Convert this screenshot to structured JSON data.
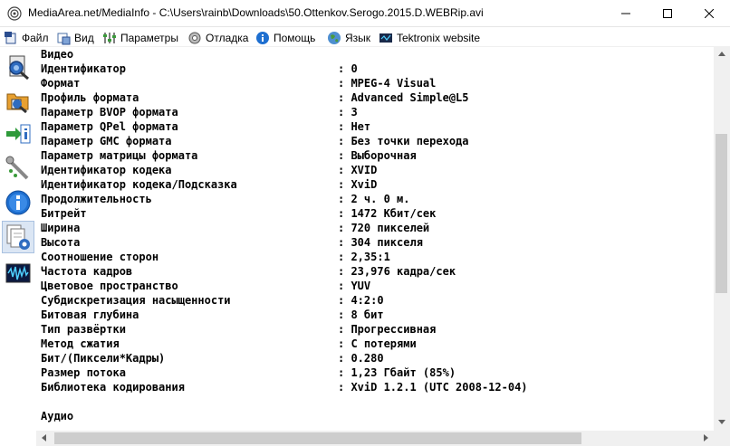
{
  "window": {
    "title": "MediaArea.net/MediaInfo - C:\\Users\\rainb\\Downloads\\50.Ottenkov.Serogo.2015.D.WEBRip.avi"
  },
  "menu": {
    "items": [
      {
        "label": "Файл",
        "icon": "file-icon"
      },
      {
        "label": "Вид",
        "icon": "view-icon"
      },
      {
        "label": "Параметры",
        "icon": "options-icon"
      },
      {
        "label": "Отладка",
        "icon": "debug-icon"
      },
      {
        "label": "Помощь",
        "icon": "help-icon"
      },
      {
        "label": "Язык",
        "icon": "language-globe-icon"
      },
      {
        "label": "Tektronix website",
        "icon": "tektronix-icon"
      }
    ]
  },
  "sidebar": {
    "buttons": [
      {
        "icon": "open-file-icon"
      },
      {
        "icon": "open-folder-icon"
      },
      {
        "icon": "export-info-icon"
      },
      {
        "icon": "preferences-icon"
      },
      {
        "icon": "about-info-icon"
      },
      {
        "icon": "sheet-view-icon",
        "active": true
      },
      {
        "icon": "waveform-icon"
      }
    ]
  },
  "report": {
    "section_video": "Видео",
    "rows": [
      {
        "key": "Идентификатор",
        "value": "0"
      },
      {
        "key": "Формат",
        "value": "MPEG-4 Visual"
      },
      {
        "key": "Профиль формата",
        "value": "Advanced Simple@L5"
      },
      {
        "key": "Параметр BVOP формата",
        "value": "3"
      },
      {
        "key": "Параметр QPel формата",
        "value": "Нет"
      },
      {
        "key": "Параметр GMC формата",
        "value": "Без точки перехода"
      },
      {
        "key": "Параметр матрицы формата",
        "value": "Выборочная"
      },
      {
        "key": "Идентификатор кодека",
        "value": "XVID"
      },
      {
        "key": "Идентификатор кодека/Подсказка",
        "value": "XviD"
      },
      {
        "key": "Продолжительность",
        "value": "2 ч. 0 м."
      },
      {
        "key": "Битрейт",
        "value": "1472 Кбит/сек"
      },
      {
        "key": "Ширина",
        "value": "720 пикселей"
      },
      {
        "key": "Высота",
        "value": "304 пикселя"
      },
      {
        "key": "Соотношение сторон",
        "value": "2,35:1"
      },
      {
        "key": "Частота кадров",
        "value": "23,976 кадра/сек"
      },
      {
        "key": "Цветовое пространство",
        "value": "YUV"
      },
      {
        "key": "Субдискретизация насыщенности",
        "value": "4:2:0"
      },
      {
        "key": "Битовая глубина",
        "value": "8 бит"
      },
      {
        "key": "Тип развёртки",
        "value": "Прогрессивная"
      },
      {
        "key": "Метод сжатия",
        "value": "С потерями"
      },
      {
        "key": "Бит/(Пиксели*Кадры)",
        "value": "0.280"
      },
      {
        "key": "Размер потока",
        "value": "1,23 Гбайт (85%)"
      },
      {
        "key": "Библиотека кодирования",
        "value": "XviD 1.2.1 (UTC 2008-12-04)"
      }
    ],
    "section_audio": "Аудио"
  }
}
